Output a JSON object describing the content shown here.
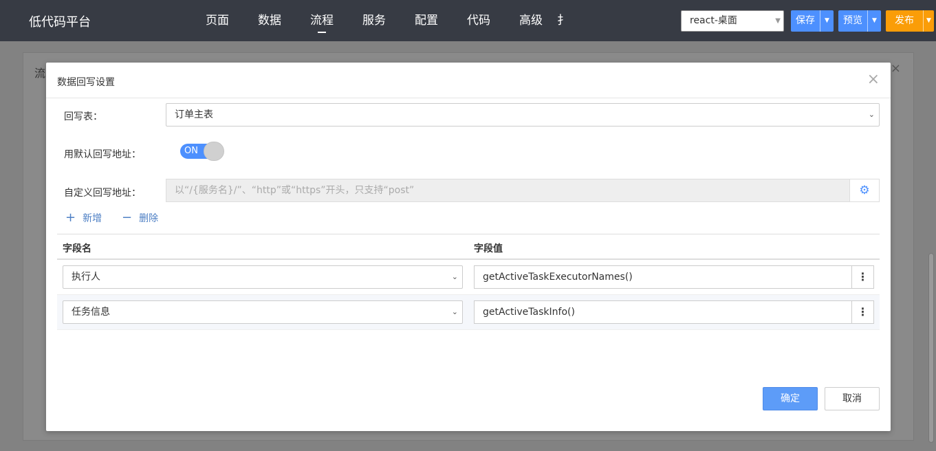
{
  "header": {
    "brand": "低代码平台",
    "nav": [
      {
        "label": "页面"
      },
      {
        "label": "数据"
      },
      {
        "label": "流程"
      },
      {
        "label": "服务"
      },
      {
        "label": "配置"
      },
      {
        "label": "代码"
      },
      {
        "label": "高级"
      },
      {
        "label": "扌"
      }
    ],
    "active_nav": "流程",
    "project_select": "react-桌面",
    "save_label": "保存",
    "preview_label": "预览",
    "publish_label": "发布"
  },
  "background": {
    "dialog_title": "流",
    "close_icon": "×"
  },
  "dialog": {
    "title": "数据回写设置",
    "close_icon": "×",
    "table_label": "回写表：",
    "table_value": "订单主表",
    "default_url_label": "用默认回写地址：",
    "toggle_text": "ON",
    "custom_url_label": "自定义回写地址：",
    "custom_url_placeholder": "以“/{服务名}/”、“http”或“https”开头，只支持“post”",
    "add_label": "新增",
    "delete_label": "删除",
    "columns": {
      "field_name": "字段名",
      "field_value": "字段值"
    },
    "rows": [
      {
        "field": "执行人",
        "value": "getActiveTaskExecutorNames()"
      },
      {
        "field": "任务信息",
        "value": "getActiveTaskInfo()"
      }
    ],
    "ok_label": "确定",
    "cancel_label": "取消"
  },
  "colors": {
    "topbar": "#373b44",
    "primary": "#4d90fe",
    "publish": "#fa9d08"
  }
}
